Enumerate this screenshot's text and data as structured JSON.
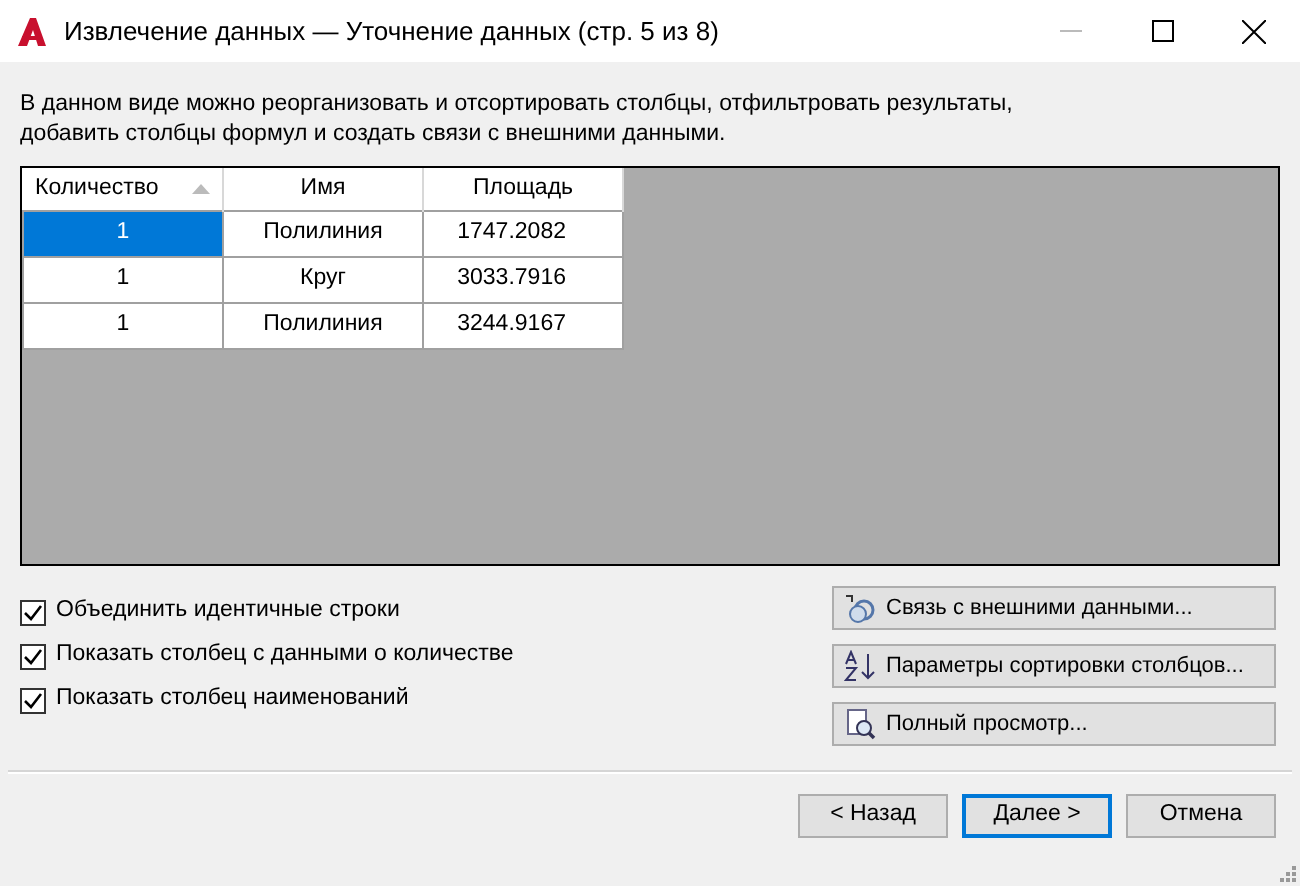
{
  "window": {
    "title": "Извлечение данных — Уточнение данных (стр. 5 из 8)"
  },
  "description": "В данном виде можно реорганизовать и отсортировать столбцы, отфильтровать результаты, добавить столбцы формул и создать связи с внешними данными.",
  "table": {
    "columns": [
      {
        "label": "Количество",
        "sorted": true
      },
      {
        "label": "Имя",
        "sorted": false
      },
      {
        "label": "Площадь",
        "sorted": false
      }
    ],
    "rows": [
      {
        "selected": true,
        "cells": [
          "1",
          "Полилиния",
          "1747.2082"
        ]
      },
      {
        "selected": false,
        "cells": [
          "1",
          "Круг",
          "3033.7916"
        ]
      },
      {
        "selected": false,
        "cells": [
          "1",
          "Полилиния",
          "3244.9167"
        ]
      }
    ]
  },
  "options": [
    {
      "label": "Объединить идентичные строки",
      "checked": true
    },
    {
      "label": "Показать столбец с данными о количестве",
      "checked": true
    },
    {
      "label": "Показать столбец наименований",
      "checked": true
    }
  ],
  "actions": [
    {
      "kind": "link",
      "label": "Связь с внешними данными..."
    },
    {
      "kind": "sort",
      "label": "Параметры сортировки столбцов..."
    },
    {
      "kind": "preview",
      "label": "Полный просмотр..."
    }
  ],
  "buttons": [
    {
      "label": "< Назад",
      "default": false
    },
    {
      "label": "Далее >",
      "default": true
    },
    {
      "label": "Отмена",
      "default": false
    }
  ]
}
